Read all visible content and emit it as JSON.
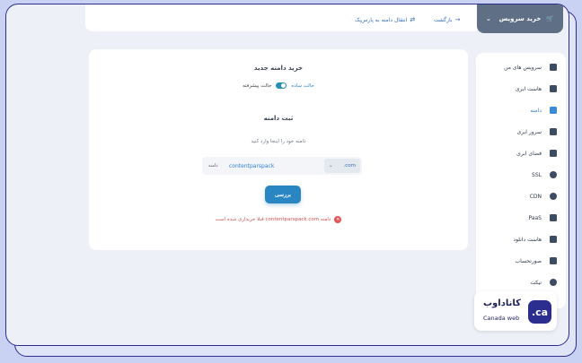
{
  "header": {
    "buy_service": "خرید سرویس",
    "back": "بازگشت",
    "transfer_domain": "انتقال دامنه به پارس‌پک"
  },
  "sidebar": {
    "items": [
      {
        "label": "سرویس های من",
        "icon": "dashboard-icon"
      },
      {
        "label": "هاست ابری",
        "icon": "host-icon"
      },
      {
        "label": "دامنه",
        "icon": "domain-icon"
      },
      {
        "label": "سرور ابری",
        "icon": "server-icon"
      },
      {
        "label": "فضای ابری",
        "icon": "cloud-storage-icon"
      },
      {
        "label": "SSL",
        "icon": "ssl-icon"
      },
      {
        "label": "CDN",
        "icon": "cdn-icon"
      },
      {
        "label": "PaaS",
        "icon": "paas-icon"
      },
      {
        "label": "هاست دانلود",
        "icon": "download-host-icon"
      },
      {
        "label": "صورتحساب",
        "icon": "invoice-icon"
      },
      {
        "label": "تیکت",
        "icon": "ticket-icon"
      }
    ],
    "active_index": 2
  },
  "main": {
    "title": "خرید دامنه جدید",
    "mode_simple": "حالت ساده",
    "mode_advanced": "حالت پیشرفته",
    "section_title": "ثبت دامنه",
    "hint": "دامنه خود را اینجا وارد کنید",
    "domain_label": "دامنه",
    "domain_value": "contentparspack",
    "tld": ".com",
    "check_button": "بررسی",
    "error_message": "دامنه contentparspack.com قبلا خریداری شده است"
  },
  "logo": {
    "badge": ".ca",
    "name_fa": "کاناداوب",
    "name_en": "Canada web"
  },
  "colors": {
    "accent": "#2a86c2",
    "active": "#2f7fd1",
    "error": "#e15656",
    "frame": "#2b2d8f"
  }
}
